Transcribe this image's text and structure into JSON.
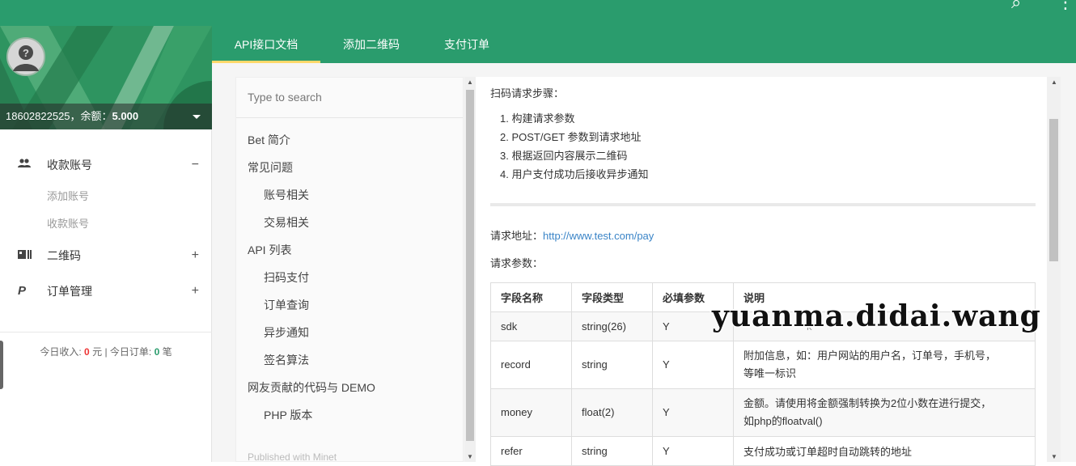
{
  "topbar": {
    "search_icon": "search-icon",
    "more_icon": "more-vertical-icon"
  },
  "sidebar": {
    "user_phone": "18602822525",
    "balance_label": "，余额：",
    "balance_value": "5.000",
    "nav": [
      {
        "label": "收款账号",
        "icon": "users-icon",
        "toggle": "−",
        "children": [
          "添加账号",
          "收款账号"
        ]
      },
      {
        "label": "二维码",
        "icon": "qrcode-card-icon",
        "toggle": "+"
      },
      {
        "label": "订单管理",
        "icon": "paypal-icon",
        "toggle": "+"
      }
    ],
    "stats": {
      "income_label": "今日收入:",
      "income_value": "0",
      "income_unit": "元",
      "sep": "|",
      "orders_label": "今日订单:",
      "orders_value": "0",
      "orders_unit": "笔"
    }
  },
  "tabs": [
    "API接口文档",
    "添加二维码",
    "支付订单"
  ],
  "doc_nav": {
    "search_placeholder": "Type to search",
    "items": [
      "Bet 简介",
      "常见问题",
      "账号相关",
      "交易相关",
      "API 列表",
      "扫码支付",
      "订单查询",
      "异步通知",
      "签名算法",
      "网友贡献的代码与 DEMO",
      "PHP 版本"
    ],
    "footer": "Published with Minet"
  },
  "doc": {
    "steps_heading": "扫码请求步骤：",
    "steps": [
      "1. 构建请求参数",
      "2. POST/GET 参数到请求地址",
      "3. 根据返回内容展示二维码",
      "4. 用户支付成功后接收异步通知"
    ],
    "req_url_label": "请求地址：",
    "req_url": "http://www.test.com/pay",
    "req_params_label": "请求参数：",
    "table": {
      "headers": [
        "字段名称",
        "字段类型",
        "必填参数",
        "说明"
      ],
      "rows": [
        [
          "sdk",
          "string(26)",
          "Y",
          "k"
        ],
        [
          "record",
          "string",
          "Y",
          "附加信息，如：用户网站的用户名，订单号，手机号，",
          "等唯一标识"
        ],
        [
          "money",
          "float(2)",
          "Y",
          "金额。请使用将金额强制转换为2位小数在进行提交，",
          "如php的floatval()"
        ],
        [
          "refer",
          "string",
          "Y",
          "支付成功或订单超时自动跳转的地址"
        ]
      ]
    }
  },
  "watermark": "yuanma.didai.wang"
}
